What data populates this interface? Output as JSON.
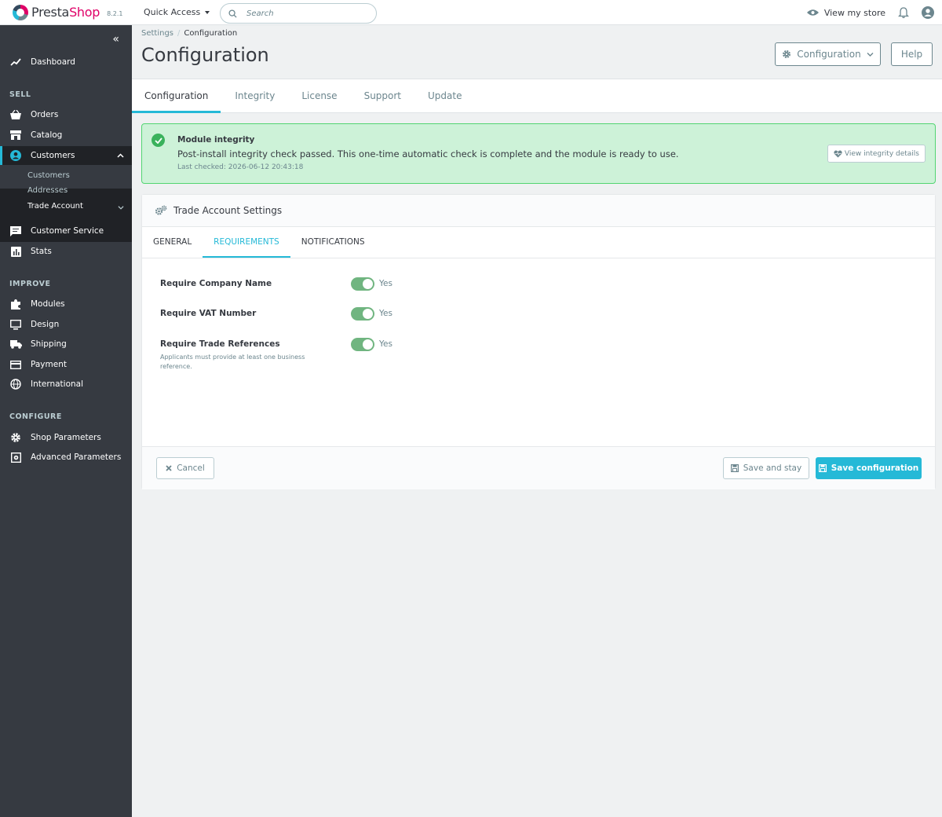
{
  "header": {
    "brand_pre": "Presta",
    "brand_post": "Shop",
    "version": "8.2.1",
    "quick_access": "Quick Access",
    "search_placeholder": "Search",
    "view_store": "View my store"
  },
  "sidebar": {
    "dashboard": "Dashboard",
    "sections": {
      "sell": "SELL",
      "improve": "IMPROVE",
      "configure": "CONFIGURE"
    },
    "sell_items": [
      "Orders",
      "Catalog",
      "Customers"
    ],
    "customers_sub": [
      "Customers",
      "Addresses",
      "Trade Account"
    ],
    "sell_after": [
      "Customer Service",
      "Stats"
    ],
    "improve_items": [
      "Modules",
      "Design",
      "Shipping",
      "Payment",
      "International"
    ],
    "configure_items": [
      "Shop Parameters",
      "Advanced Parameters"
    ]
  },
  "breadcrumb": {
    "parent": "Settings",
    "sep": "/",
    "current": "Configuration"
  },
  "page": {
    "title": "Configuration",
    "config_button": "Configuration",
    "help_button": "Help"
  },
  "tabs": [
    "Configuration",
    "Integrity",
    "License",
    "Support",
    "Update"
  ],
  "alert": {
    "title": "Module integrity",
    "text": "Post-install integrity check passed. This one-time automatic check is complete and the module is ready to use.",
    "meta": "Last checked: 2026-06-12 20:43:18",
    "button": "View integrity details"
  },
  "panel": {
    "title": "Trade Account Settings",
    "subtabs": [
      "GENERAL",
      "REQUIREMENTS",
      "NOTIFICATIONS"
    ],
    "fields": [
      {
        "label": "Require Company Name",
        "value": "Yes",
        "enabled": true,
        "help": ""
      },
      {
        "label": "Require VAT Number",
        "value": "Yes",
        "enabled": true,
        "help": ""
      },
      {
        "label": "Require Trade References",
        "value": "Yes",
        "enabled": true,
        "help": "Applicants must provide at least one business reference."
      }
    ],
    "cancel": "Cancel",
    "save_stay": "Save and stay",
    "save": "Save configuration"
  },
  "colors": {
    "accent": "#25b9d7",
    "brand": "#df0067",
    "sidebar": "#363a41",
    "success": "#70b580"
  }
}
